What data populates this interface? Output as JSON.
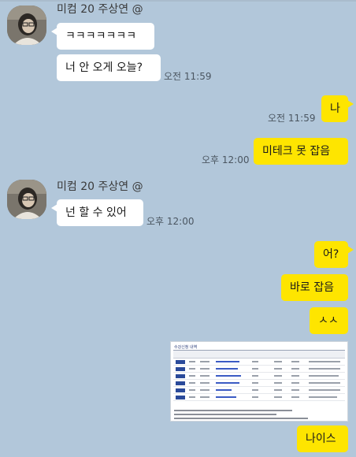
{
  "chat": {
    "sender_1": "미컴 20 주상연 @",
    "msg_1": "ㅋㅋㅋㅋㅋㅋㅋ",
    "msg_2": "너 안 오게 오늘?",
    "time_1": "오전 11:59",
    "reply_1": "나",
    "time_2": "오전 11:59",
    "reply_2": "미테크 못 잡음",
    "time_3": "오후 12:00",
    "sender_2": "미컴 20 주상연 @",
    "msg_3": "넌 할 수 있어",
    "time_4": "오후 12:00",
    "reply_3": "어?",
    "reply_4": "바로 잡음",
    "reply_5": "ㅅㅅ",
    "reply_6": "나이스"
  },
  "attachment": {
    "title": "수강신청 내역"
  },
  "colors": {
    "background": "#b2c7da",
    "incoming_bubble": "#ffffff",
    "outgoing_bubble": "#fee500"
  },
  "icons": [
    "avatar-photo",
    "screenshot-thumbnail"
  ]
}
